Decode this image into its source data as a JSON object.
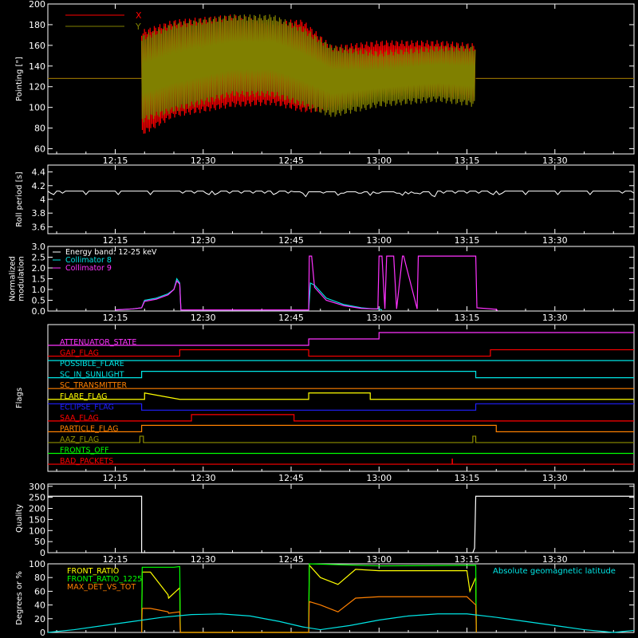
{
  "palette": {
    "background": "#000000",
    "axis": "#ffffff",
    "x_series": "#ff0000",
    "y_series": "#808000",
    "white": "#ffffff",
    "cyan": "#00e5e5",
    "magenta": "#ff33ff",
    "yellow": "#ffff00",
    "green": "#00ff00",
    "orange": "#ff8000",
    "blue": "#2020ff",
    "red": "#ff0000",
    "olive": "#909000"
  },
  "time_axis": {
    "tick_labels": [
      "12:15",
      "12:30",
      "12:45",
      "13:00",
      "13:15",
      "13:30"
    ],
    "tick_minutes": [
      735,
      750,
      765,
      780,
      795,
      810
    ],
    "range_minutes": [
      723.5,
      823.5
    ]
  },
  "chart_data": [
    {
      "id": "pointing",
      "type": "line",
      "ylabel": "Pointing [\"]",
      "ylim": [
        55,
        200
      ],
      "yticks": [
        60,
        80,
        100,
        120,
        140,
        160,
        180,
        200
      ],
      "legend": {
        "placement": "top-left",
        "entries": [
          "X",
          "Y"
        ]
      },
      "series": [
        {
          "name": "X",
          "color": "#ff0000",
          "baseline": 128,
          "active_range": [
            739.5,
            796.5
          ],
          "envelope": [
            {
              "t": 739.5,
              "min": 72,
              "max": 175
            },
            {
              "t": 745,
              "min": 90,
              "max": 185
            },
            {
              "t": 755,
              "min": 100,
              "max": 190
            },
            {
              "t": 762,
              "min": 102,
              "max": 185
            },
            {
              "t": 767,
              "min": 95,
              "max": 185
            },
            {
              "t": 772,
              "min": 95,
              "max": 160
            },
            {
              "t": 780,
              "min": 110,
              "max": 165
            },
            {
              "t": 790,
              "min": 110,
              "max": 165
            },
            {
              "t": 796.5,
              "min": 105,
              "max": 162
            }
          ]
        },
        {
          "name": "Y",
          "color": "#808000",
          "baseline": 128,
          "active_range": [
            739.5,
            796.5
          ],
          "envelope": [
            {
              "t": 739.5,
              "min": 85,
              "max": 170
            },
            {
              "t": 745,
              "min": 95,
              "max": 182
            },
            {
              "t": 755,
              "min": 110,
              "max": 190
            },
            {
              "t": 762,
              "min": 110,
              "max": 190
            },
            {
              "t": 767,
              "min": 100,
              "max": 178
            },
            {
              "t": 772,
              "min": 90,
              "max": 160
            },
            {
              "t": 780,
              "min": 100,
              "max": 155
            },
            {
              "t": 790,
              "min": 105,
              "max": 160
            },
            {
              "t": 796.5,
              "min": 100,
              "max": 160
            }
          ]
        }
      ]
    },
    {
      "id": "roll_period",
      "type": "line",
      "ylabel": "Roll period [s]",
      "ylim": [
        3.5,
        4.5
      ],
      "yticks": [
        3.6,
        3.8,
        4.0,
        4.2,
        4.4
      ],
      "series": [
        {
          "color": "#ffffff",
          "x": [
            723.5,
            739,
            744,
            760,
            770,
            780,
            790,
            795,
            823.5
          ],
          "y": [
            4.12,
            4.12,
            4.1,
            4.12,
            4.11,
            4.1,
            4.12,
            4.09,
            4.12
          ]
        }
      ]
    },
    {
      "id": "modulation",
      "type": "line",
      "ylabel": "Normalized modulation",
      "ylim": [
        0,
        3.0
      ],
      "yticks": [
        0.0,
        0.5,
        1.0,
        1.5,
        2.0,
        2.5,
        3.0
      ],
      "yticklabels": [
        "0.0",
        "0.5",
        "1.0",
        "1.5",
        "2.0",
        "2.5",
        "3.0"
      ],
      "legend": {
        "placement": "top-left",
        "entries": [
          "Energy band: 12-25 keV",
          "Collimator 8",
          "Collimator 9"
        ]
      },
      "series": [
        {
          "name": "Collimator 8",
          "color": "#00e5e5",
          "x": [
            735,
            738,
            739.5,
            740,
            742,
            744,
            745,
            745.5,
            746,
            746.2,
            768,
            768.3,
            769,
            771,
            774,
            777,
            779,
            780,
            780.5
          ],
          "y": [
            0.05,
            0.1,
            0.15,
            0.5,
            0.6,
            0.8,
            1.0,
            1.5,
            1.3,
            0.05,
            0.05,
            1.3,
            1.2,
            0.6,
            0.3,
            0.15,
            0.1,
            0.1,
            0.05
          ]
        },
        {
          "name": "Collimator 9",
          "color": "#ff33ff",
          "x": [
            735,
            738,
            739.5,
            740,
            742,
            744,
            745,
            745.5,
            746,
            746.2,
            768,
            768.1,
            768.5,
            769,
            771,
            774,
            777,
            779,
            779.8,
            780.0,
            780.5,
            781,
            781.3,
            782.5,
            783,
            784,
            784.2,
            786.5,
            786.7,
            796.5,
            796.7,
            800,
            800.2
          ],
          "y": [
            0.05,
            0.1,
            0.15,
            0.45,
            0.55,
            0.75,
            1.0,
            1.4,
            1.25,
            0.05,
            0.05,
            2.55,
            2.55,
            1.1,
            0.5,
            0.25,
            0.12,
            0.1,
            0.1,
            2.55,
            2.55,
            0.1,
            2.55,
            2.55,
            0.1,
            2.55,
            2.55,
            0.1,
            2.55,
            2.55,
            0.15,
            0.08,
            0.02
          ]
        }
      ]
    },
    {
      "id": "flags",
      "type": "line",
      "ylabel": "Flags",
      "rows": [
        {
          "label": "ATTENUATOR_STATE",
          "color": "#ff33ff",
          "x": [
            723.5,
            768,
            768,
            780,
            780,
            823.5
          ],
          "y": [
            0,
            0,
            1,
            1,
            2,
            2
          ]
        },
        {
          "label": "GAP_FLAG",
          "color": "#ff0000",
          "x": [
            723.5,
            746,
            746,
            768,
            768,
            799,
            799,
            823.5
          ],
          "y": [
            0,
            0,
            1,
            1,
            0,
            0,
            1,
            1
          ]
        },
        {
          "label": "POSSIBLE_FLARE",
          "color": "#00e5e5",
          "x": [
            723.5,
            823.5
          ],
          "y": [
            1,
            1
          ]
        },
        {
          "label": "SC_IN_SUNLIGHT",
          "color": "#00e5e5",
          "x": [
            723.5,
            739.5,
            739.5,
            796.5,
            796.5,
            823.5
          ],
          "y": [
            0,
            0,
            1,
            1,
            0,
            0
          ]
        },
        {
          "label": "SC_TRANSMITTER",
          "color": "#ff8000",
          "x": [
            723.5,
            823.5
          ],
          "y": [
            0,
            0
          ]
        },
        {
          "label": "FLARE_FLAG",
          "color": "#ffff00",
          "x": [
            723.5,
            740,
            740,
            746,
            746,
            768,
            768,
            778.5,
            778.5,
            823.5
          ],
          "y": [
            0,
            0,
            1,
            0,
            0,
            0,
            1,
            1,
            0,
            0
          ]
        },
        {
          "label": "ECLIPSE_FLAG",
          "color": "#2020ff",
          "x": [
            723.5,
            739.5,
            739.5,
            796.5,
            796.5,
            823.5
          ],
          "y": [
            1,
            1,
            0,
            0,
            1,
            1
          ]
        },
        {
          "label": "SAA_FLAG",
          "color": "#ff0000",
          "x": [
            723.5,
            748,
            748,
            765.5,
            765.5,
            823.5
          ],
          "y": [
            0,
            0,
            1,
            1,
            0,
            0
          ]
        },
        {
          "label": "PARTICLE_FLAG",
          "color": "#ff8000",
          "x": [
            723.5,
            739.5,
            739.5,
            796.5,
            796.5,
            800,
            800,
            823.5
          ],
          "y": [
            0,
            0,
            1,
            1,
            1,
            1,
            0,
            0
          ]
        },
        {
          "label": "AAZ_FLAG",
          "color": "#909000",
          "x": [
            723.5,
            739.2,
            739.2,
            739.8,
            739.8,
            796,
            796,
            796.5,
            796.5,
            823.5
          ],
          "y": [
            0,
            0,
            1,
            1,
            0,
            0,
            1,
            1,
            0,
            0
          ]
        },
        {
          "label": "FRONTS_OFF",
          "color": "#00ff00",
          "x": [
            723.5,
            823.5
          ],
          "y": [
            0,
            0
          ]
        },
        {
          "label": "BAD_PACKETS",
          "color": "#ff0000",
          "x": [
            723.5,
            823.5
          ],
          "y": [
            0,
            0
          ],
          "spikes": [
            792.5
          ]
        }
      ]
    },
    {
      "id": "quality",
      "type": "line",
      "ylabel": "Quality",
      "ylim": [
        0,
        310
      ],
      "yticks": [
        0,
        50,
        100,
        150,
        200,
        250,
        300
      ],
      "series": [
        {
          "color": "#ffffff",
          "x": [
            723.5,
            739.5,
            739.5,
            796.0,
            796.3,
            796.5,
            823.5
          ],
          "y": [
            255,
            255,
            0,
            0,
            20,
            255,
            255
          ]
        }
      ]
    },
    {
      "id": "degrees",
      "type": "line",
      "ylabel": "Degrees or %",
      "ylim": [
        0,
        100
      ],
      "yticks": [
        0,
        20,
        40,
        60,
        80,
        100
      ],
      "legend": {
        "placement": "top-left",
        "entries": [
          "FRONT_RATIO",
          "FRONT_RATIO_1225",
          "MAX_DET_VS_TOT"
        ]
      },
      "annotation": "Absolute geomagnetic latitude",
      "series": [
        {
          "name": "FRONT_RATIO",
          "color": "#ffff00",
          "x": [
            739.5,
            739.6,
            741,
            744,
            744.1,
            746,
            746.1,
            768,
            768.1,
            770,
            773,
            776,
            780,
            790,
            795,
            795.5,
            796.5,
            796.6
          ],
          "y": [
            0,
            88,
            88,
            55,
            50,
            65,
            0,
            0,
            98,
            80,
            70,
            92,
            90,
            90,
            90,
            60,
            80,
            0
          ]
        },
        {
          "name": "FRONT_RATIO_1225",
          "color": "#00ff00",
          "x": [
            739.5,
            739.6,
            745,
            746,
            746.1,
            768,
            768.1,
            780,
            796.5,
            796.6
          ],
          "y": [
            0,
            95,
            95,
            96,
            0,
            0,
            100,
            97,
            98,
            0
          ]
        },
        {
          "name": "MAX_DET_VS_TOT",
          "color": "#ff8000",
          "x": [
            739.5,
            739.6,
            741,
            744,
            744.1,
            746,
            746.1,
            768,
            768.1,
            770,
            773,
            776,
            780,
            790,
            795,
            796.5,
            796.6
          ],
          "y": [
            0,
            35,
            35,
            30,
            28,
            30,
            0,
            0,
            45,
            40,
            30,
            50,
            52,
            52,
            52,
            40,
            0
          ]
        },
        {
          "name": "Absolute geomagnetic latitude",
          "color": "#00e5e5",
          "x": [
            723.5,
            728,
            733,
            738,
            743,
            748,
            753,
            758,
            763,
            767,
            770,
            775,
            780,
            785,
            790,
            795,
            800,
            805,
            810,
            815,
            820,
            823.5
          ],
          "y": [
            0,
            4,
            10,
            16,
            22,
            26,
            27,
            24,
            16,
            8,
            4,
            10,
            18,
            24,
            27,
            27,
            22,
            16,
            10,
            4,
            0,
            3
          ]
        }
      ]
    }
  ]
}
